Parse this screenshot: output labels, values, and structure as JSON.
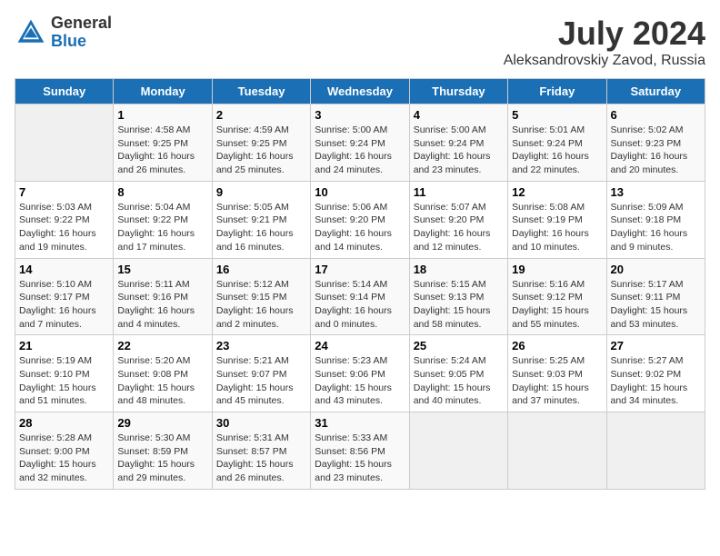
{
  "header": {
    "logo_general": "General",
    "logo_blue": "Blue",
    "title": "July 2024",
    "subtitle": "Aleksandrovskiy Zavod, Russia"
  },
  "columns": [
    "Sunday",
    "Monday",
    "Tuesday",
    "Wednesday",
    "Thursday",
    "Friday",
    "Saturday"
  ],
  "weeks": [
    {
      "days": [
        {
          "num": "",
          "detail": ""
        },
        {
          "num": "1",
          "detail": "Sunrise: 4:58 AM\nSunset: 9:25 PM\nDaylight: 16 hours\nand 26 minutes."
        },
        {
          "num": "2",
          "detail": "Sunrise: 4:59 AM\nSunset: 9:25 PM\nDaylight: 16 hours\nand 25 minutes."
        },
        {
          "num": "3",
          "detail": "Sunrise: 5:00 AM\nSunset: 9:24 PM\nDaylight: 16 hours\nand 24 minutes."
        },
        {
          "num": "4",
          "detail": "Sunrise: 5:00 AM\nSunset: 9:24 PM\nDaylight: 16 hours\nand 23 minutes."
        },
        {
          "num": "5",
          "detail": "Sunrise: 5:01 AM\nSunset: 9:24 PM\nDaylight: 16 hours\nand 22 minutes."
        },
        {
          "num": "6",
          "detail": "Sunrise: 5:02 AM\nSunset: 9:23 PM\nDaylight: 16 hours\nand 20 minutes."
        }
      ]
    },
    {
      "days": [
        {
          "num": "7",
          "detail": "Sunrise: 5:03 AM\nSunset: 9:22 PM\nDaylight: 16 hours\nand 19 minutes."
        },
        {
          "num": "8",
          "detail": "Sunrise: 5:04 AM\nSunset: 9:22 PM\nDaylight: 16 hours\nand 17 minutes."
        },
        {
          "num": "9",
          "detail": "Sunrise: 5:05 AM\nSunset: 9:21 PM\nDaylight: 16 hours\nand 16 minutes."
        },
        {
          "num": "10",
          "detail": "Sunrise: 5:06 AM\nSunset: 9:20 PM\nDaylight: 16 hours\nand 14 minutes."
        },
        {
          "num": "11",
          "detail": "Sunrise: 5:07 AM\nSunset: 9:20 PM\nDaylight: 16 hours\nand 12 minutes."
        },
        {
          "num": "12",
          "detail": "Sunrise: 5:08 AM\nSunset: 9:19 PM\nDaylight: 16 hours\nand 10 minutes."
        },
        {
          "num": "13",
          "detail": "Sunrise: 5:09 AM\nSunset: 9:18 PM\nDaylight: 16 hours\nand 9 minutes."
        }
      ]
    },
    {
      "days": [
        {
          "num": "14",
          "detail": "Sunrise: 5:10 AM\nSunset: 9:17 PM\nDaylight: 16 hours\nand 7 minutes."
        },
        {
          "num": "15",
          "detail": "Sunrise: 5:11 AM\nSunset: 9:16 PM\nDaylight: 16 hours\nand 4 minutes."
        },
        {
          "num": "16",
          "detail": "Sunrise: 5:12 AM\nSunset: 9:15 PM\nDaylight: 16 hours\nand 2 minutes."
        },
        {
          "num": "17",
          "detail": "Sunrise: 5:14 AM\nSunset: 9:14 PM\nDaylight: 16 hours\nand 0 minutes."
        },
        {
          "num": "18",
          "detail": "Sunrise: 5:15 AM\nSunset: 9:13 PM\nDaylight: 15 hours\nand 58 minutes."
        },
        {
          "num": "19",
          "detail": "Sunrise: 5:16 AM\nSunset: 9:12 PM\nDaylight: 15 hours\nand 55 minutes."
        },
        {
          "num": "20",
          "detail": "Sunrise: 5:17 AM\nSunset: 9:11 PM\nDaylight: 15 hours\nand 53 minutes."
        }
      ]
    },
    {
      "days": [
        {
          "num": "21",
          "detail": "Sunrise: 5:19 AM\nSunset: 9:10 PM\nDaylight: 15 hours\nand 51 minutes."
        },
        {
          "num": "22",
          "detail": "Sunrise: 5:20 AM\nSunset: 9:08 PM\nDaylight: 15 hours\nand 48 minutes."
        },
        {
          "num": "23",
          "detail": "Sunrise: 5:21 AM\nSunset: 9:07 PM\nDaylight: 15 hours\nand 45 minutes."
        },
        {
          "num": "24",
          "detail": "Sunrise: 5:23 AM\nSunset: 9:06 PM\nDaylight: 15 hours\nand 43 minutes."
        },
        {
          "num": "25",
          "detail": "Sunrise: 5:24 AM\nSunset: 9:05 PM\nDaylight: 15 hours\nand 40 minutes."
        },
        {
          "num": "26",
          "detail": "Sunrise: 5:25 AM\nSunset: 9:03 PM\nDaylight: 15 hours\nand 37 minutes."
        },
        {
          "num": "27",
          "detail": "Sunrise: 5:27 AM\nSunset: 9:02 PM\nDaylight: 15 hours\nand 34 minutes."
        }
      ]
    },
    {
      "days": [
        {
          "num": "28",
          "detail": "Sunrise: 5:28 AM\nSunset: 9:00 PM\nDaylight: 15 hours\nand 32 minutes."
        },
        {
          "num": "29",
          "detail": "Sunrise: 5:30 AM\nSunset: 8:59 PM\nDaylight: 15 hours\nand 29 minutes."
        },
        {
          "num": "30",
          "detail": "Sunrise: 5:31 AM\nSunset: 8:57 PM\nDaylight: 15 hours\nand 26 minutes."
        },
        {
          "num": "31",
          "detail": "Sunrise: 5:33 AM\nSunset: 8:56 PM\nDaylight: 15 hours\nand 23 minutes."
        },
        {
          "num": "",
          "detail": ""
        },
        {
          "num": "",
          "detail": ""
        },
        {
          "num": "",
          "detail": ""
        }
      ]
    }
  ]
}
